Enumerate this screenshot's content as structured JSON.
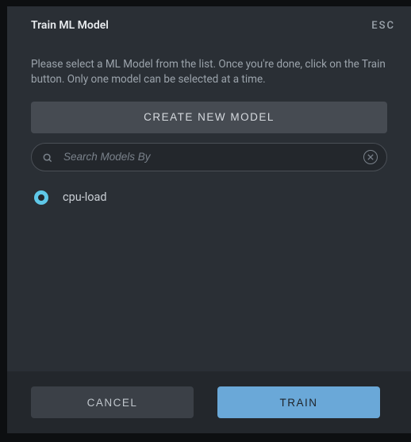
{
  "modal": {
    "title": "Train ML Model",
    "esc_label": "ESC",
    "description": "Please select a ML Model from the list. Once you're done, click on the Train button. Only one model can be selected at a time.",
    "create_button": "CREATE NEW MODEL",
    "search": {
      "placeholder": "Search Models By"
    },
    "models": [
      {
        "label": "cpu-load",
        "selected": true
      }
    ],
    "footer": {
      "cancel": "CANCEL",
      "train": "TRAIN"
    }
  },
  "colors": {
    "accent": "#5fc8e8",
    "primary_button": "#6aa8d8",
    "modal_bg": "#2a2f35",
    "footer_bg": "#23272c"
  }
}
